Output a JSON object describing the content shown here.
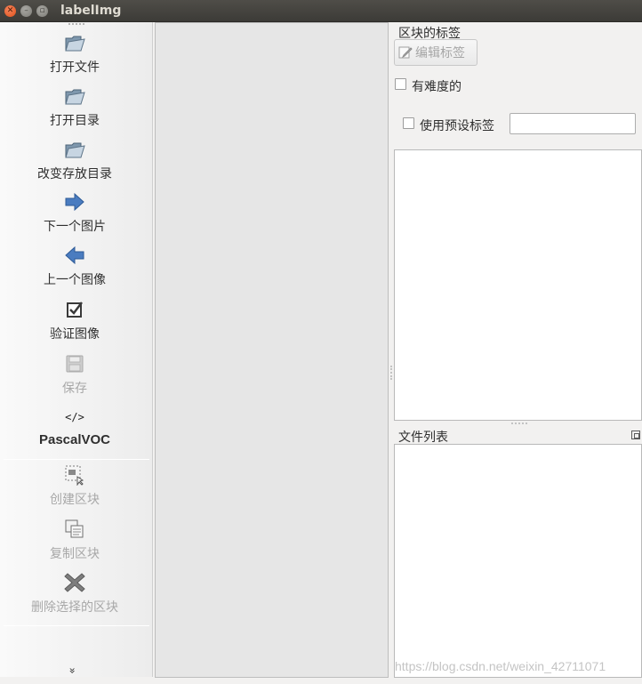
{
  "window": {
    "title": "labelImg"
  },
  "toolbar": {
    "items": [
      {
        "label": "打开文件",
        "icon": "open-folder-icon"
      },
      {
        "label": "打开目录",
        "icon": "open-folder-icon"
      },
      {
        "label": "改变存放目录",
        "icon": "open-folder-icon"
      },
      {
        "label": "下一个图片",
        "icon": "arrow-right-icon"
      },
      {
        "label": "上一个图像",
        "icon": "arrow-left-icon"
      },
      {
        "label": "验证图像",
        "icon": "checkbox-icon"
      },
      {
        "label": "保存",
        "icon": "save-icon",
        "disabled": true
      },
      {
        "label": "PascalVOC",
        "icon": "code-icon"
      },
      {
        "label": "创建区块",
        "icon": "create-box-icon",
        "disabled": true
      },
      {
        "label": "复制区块",
        "icon": "copy-box-icon",
        "disabled": true
      },
      {
        "label": "删除选择的区块",
        "icon": "delete-icon",
        "disabled": true
      }
    ],
    "more_glyph": "»"
  },
  "labels_dock": {
    "title": "区块的标签",
    "edit_button": "编辑标签",
    "difficult_label": "有难度的",
    "default_label_checkbox": "使用预设标签",
    "default_label_value": ""
  },
  "file_dock": {
    "title": "文件列表"
  },
  "watermark": "https://blog.csdn.net/weixin_42711071",
  "colors": {
    "titlebar": "#3c3b37",
    "close_button": "#e0521b",
    "arrow_blue": "#4a7cc0",
    "canvas": "#e6e6e6"
  }
}
